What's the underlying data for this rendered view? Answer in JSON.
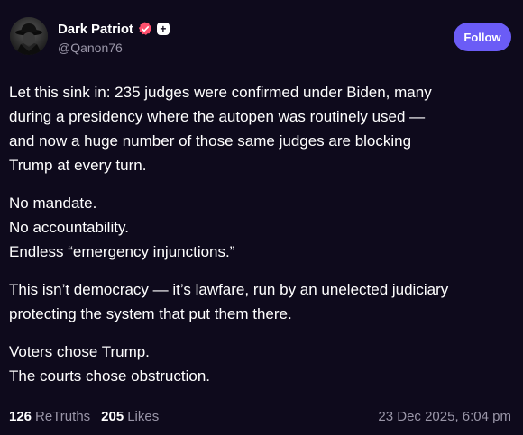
{
  "author": {
    "display_name": "Dark Patriot",
    "handle": "@Qanon76",
    "verified_icon": "verified-badge-icon",
    "plus_badge": "+",
    "verified_color": "#ff4f6d"
  },
  "follow_button": {
    "label": "Follow",
    "color": "#6b5cf6"
  },
  "post": {
    "paragraphs": [
      {
        "lines": [
          "Let this sink in: 235 judges were confirmed under Biden, many",
          "during a presidency where the autopen was routinely used —",
          "and now a huge number of those same judges are blocking",
          "Trump at every turn."
        ]
      },
      {
        "lines": [
          "No mandate.",
          "No accountability.",
          "Endless “emergency injunctions.”"
        ]
      },
      {
        "lines": [
          "This isn’t democracy — it’s lawfare, run by an unelected judiciary",
          "protecting the system that put them there."
        ]
      },
      {
        "lines": [
          "Voters chose Trump.",
          "The courts chose obstruction."
        ]
      }
    ]
  },
  "stats": {
    "retruths_count": "126",
    "retruths_label": "ReTruths",
    "likes_count": "205",
    "likes_label": "Likes"
  },
  "timestamp": "23 Dec 2025, 6:04 pm",
  "colors": {
    "background": "#0e0a1c",
    "muted_text": "#9a96a8",
    "text": "#ffffff"
  }
}
